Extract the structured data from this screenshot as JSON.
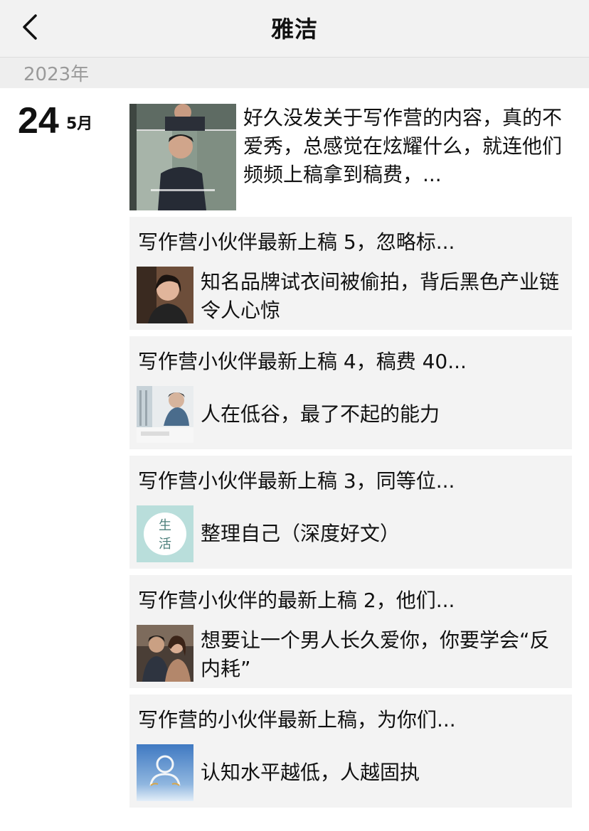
{
  "nav": {
    "title": "雅洁"
  },
  "timeline": {
    "year": "2023年",
    "day": "24",
    "month": "5月"
  },
  "first_post": {
    "text": "好久没发关于写作营的内容，真的不爱秀，总感觉在炫耀什么，就连他们频频上稿拿到稿费，..."
  },
  "cards": [
    {
      "title": "写作营小伙伴最新上稿 5，忽略标...",
      "link_text": "知名品牌试衣间被偷拍，背后黑色产业链令人心惊"
    },
    {
      "title": "写作营小伙伴最新上稿 4，稿费 40...",
      "link_text": "人在低谷，最了不起的能力"
    },
    {
      "title": "写作营小伙伴最新上稿 3，同等位...",
      "link_text": "整理自己（深度好文）",
      "thumb_chars": [
        "生",
        "活"
      ]
    },
    {
      "title": "写作营小伙伴的最新上稿 2，他们...",
      "link_text": "想要让一个男人长久爱你，你要学会“反内耗”"
    },
    {
      "title": "写作营的小伙伴最新上稿，为你们...",
      "link_text": "认知水平越低，人越固执"
    }
  ]
}
